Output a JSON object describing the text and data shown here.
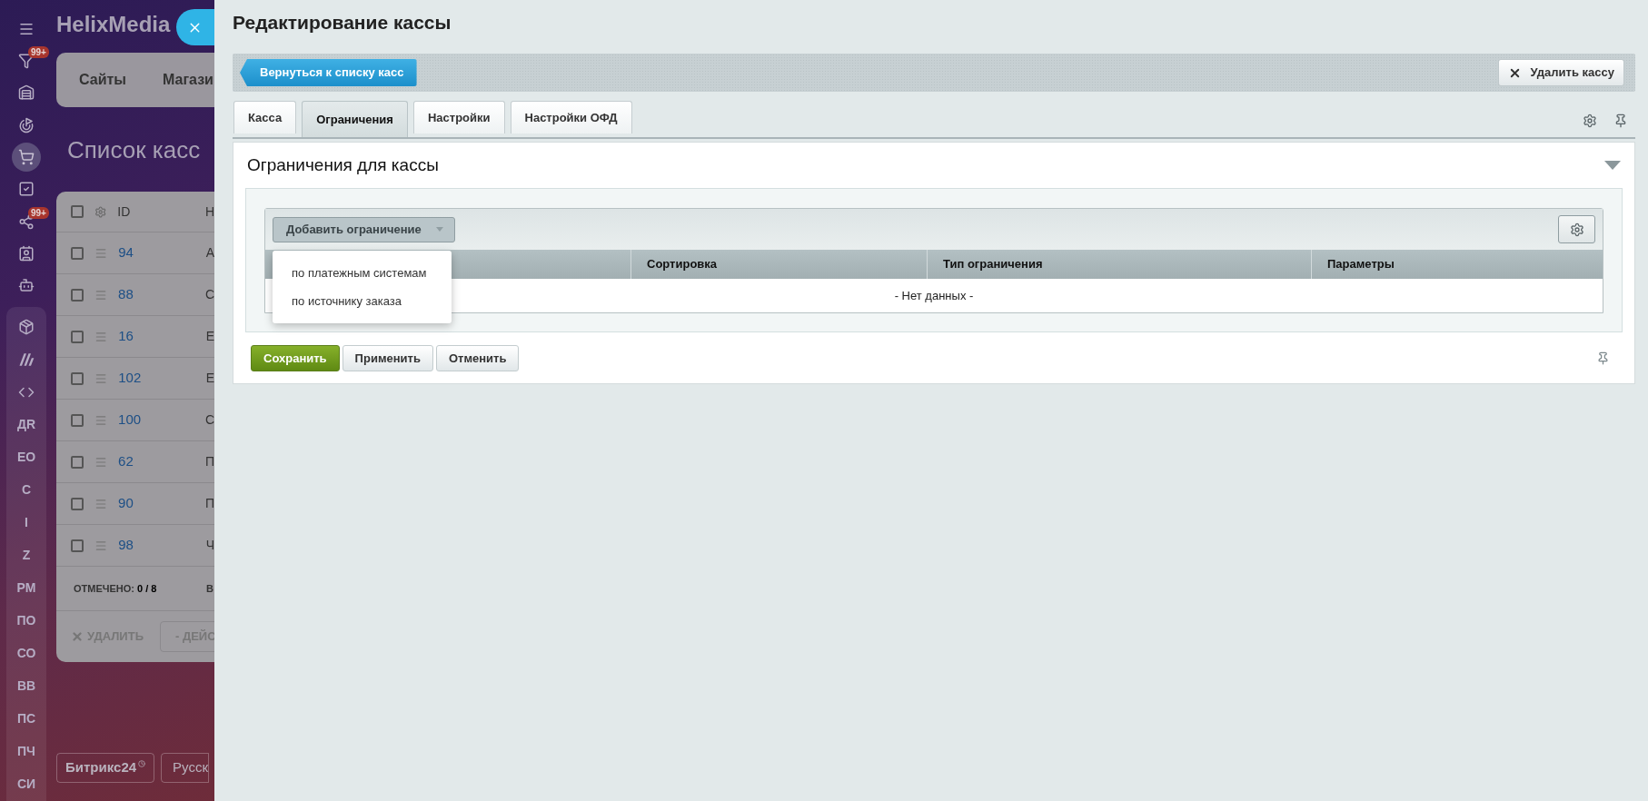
{
  "background": {
    "app_title": "HelixMedia",
    "sidebar_icons": [
      {
        "selected": false
      },
      {
        "selected": false,
        "badge": "99+"
      },
      {
        "selected": false
      },
      {
        "selected": false
      },
      {
        "selected": true
      },
      {
        "selected": false
      },
      {
        "selected": false,
        "badge": "99+"
      },
      {
        "selected": false
      },
      {
        "selected": false
      }
    ],
    "sidebar_group_icons": [
      {
        "selected": false
      },
      {
        "selected": false
      },
      {
        "selected": false
      }
    ],
    "sidebar_letters": [
      "ДR",
      "EO",
      "С",
      "I",
      "Z",
      "PM",
      "ПО",
      "СО",
      "ВВ",
      "ПС",
      "ПЧ",
      "СИ"
    ],
    "nav_items": [
      "Сайты",
      "Магази"
    ],
    "page_title": "Список касс",
    "table": {
      "header_checked": false,
      "columns": [
        "ID",
        "Н"
      ],
      "rows": [
        {
          "checked": false,
          "id": "94",
          "column_2": "А"
        },
        {
          "checked": false,
          "id": "88",
          "column_2": "С"
        },
        {
          "checked": false,
          "id": "16",
          "column_2": "Е"
        },
        {
          "checked": false,
          "id": "102",
          "column_2": "Е"
        },
        {
          "checked": false,
          "id": "100",
          "column_2": "С"
        },
        {
          "checked": false,
          "id": "62",
          "column_2": "П"
        },
        {
          "checked": false,
          "id": "90",
          "column_2": "П"
        },
        {
          "checked": false,
          "id": "98",
          "column_2": "Ч"
        }
      ],
      "footer": {
        "checked_label": "ОТМЕЧЕНО:",
        "checked_value": "0 / 8",
        "column_2": "В"
      },
      "actions": [
        "УДАЛИТЬ",
        "- ДЕЙС"
      ]
    },
    "footer_buttons": [
      "Битрикс24",
      "Русск"
    ]
  },
  "panel": {
    "title": "Редактирование кассы",
    "back_button": "Вернуться к списку касс",
    "delete_button": "Удалить кассу",
    "tabs": [
      {
        "label": "Касса",
        "selected": false
      },
      {
        "label": "Ограничения",
        "selected": true
      },
      {
        "label": "Настройки",
        "selected": false
      },
      {
        "label": "Настройки ОФД",
        "selected": false
      }
    ],
    "section": {
      "title": "Ограничения для кассы",
      "expanded": true,
      "add_button": "Добавить ограничение",
      "menu": {
        "open": true,
        "items": [
          "по платежным системам",
          "по источнику заказа"
        ]
      },
      "columns": [
        "",
        "Сортировка",
        "Тип ограничения",
        "Параметры"
      ],
      "empty_text": "- Нет данных -"
    },
    "buttons": [
      {
        "label": "Сохранить",
        "kind": "primary"
      },
      {
        "label": "Применить",
        "kind": "secondary"
      },
      {
        "label": "Отменить",
        "kind": "secondary"
      }
    ]
  }
}
